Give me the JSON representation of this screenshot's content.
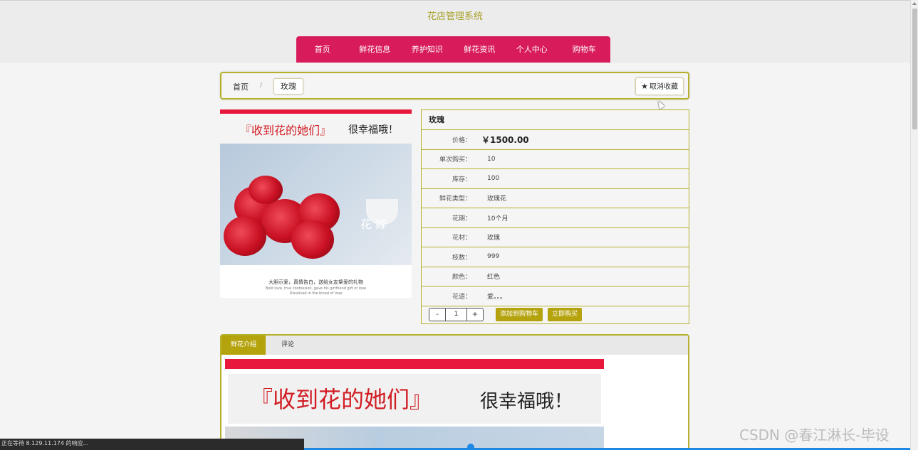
{
  "site": {
    "title": "花店管理系统"
  },
  "nav": {
    "items": [
      {
        "label": "首页"
      },
      {
        "label": "鲜花信息"
      },
      {
        "label": "养护知识"
      },
      {
        "label": "鲜花资讯"
      },
      {
        "label": "个人中心"
      },
      {
        "label": "购物车"
      }
    ]
  },
  "breadcrumb": {
    "home": "首页",
    "separator": "/",
    "current": "玫瑰"
  },
  "favorite": {
    "label": "取消收藏",
    "icon": "star-icon"
  },
  "product_image": {
    "title": "『收到花的她们』",
    "subtitle": "很幸福哦！",
    "brand": "花 嫁",
    "caption": "大胆示爱，真情告白，送给女友挚爱的礼物",
    "caption_en_1": "Bold love, true confession, gave his girlfriend gift of love",
    "caption_en_2": "Dissolved in the blood of love"
  },
  "product": {
    "name": "玫瑰",
    "price_label": "价格：",
    "price": "￥1500.00",
    "fields": [
      {
        "label": "单次购买：",
        "value": "10"
      },
      {
        "label": "库存：",
        "value": "100"
      },
      {
        "label": "鲜花类型：",
        "value": "玫瑰花"
      },
      {
        "label": "花期：",
        "value": "10个月"
      },
      {
        "label": "花材：",
        "value": "玫瑰"
      },
      {
        "label": "枝数：",
        "value": "999"
      },
      {
        "label": "颜色：",
        "value": "红色"
      },
      {
        "label": "花语：",
        "value": "爱。。。"
      }
    ],
    "quantity": "1",
    "minus_label": "-",
    "plus_label": "+",
    "add_to_cart_label": "添加到购物车",
    "buy_now_label": "立即购买"
  },
  "detail": {
    "tabs": [
      {
        "label": "鲜花介绍"
      },
      {
        "label": "评论"
      }
    ],
    "banner_title": "『收到花的她们』",
    "banner_subtitle": "很幸福哦！"
  },
  "status_bar": {
    "text": "正在等待 8.129.11.174 的响应..."
  },
  "watermark": {
    "text": "CSDN @春江淋长-毕设"
  },
  "colors": {
    "accent": "#d81b5a",
    "gold": "#b5a30e",
    "border": "#b5b02a",
    "title": "#a8a22b"
  }
}
